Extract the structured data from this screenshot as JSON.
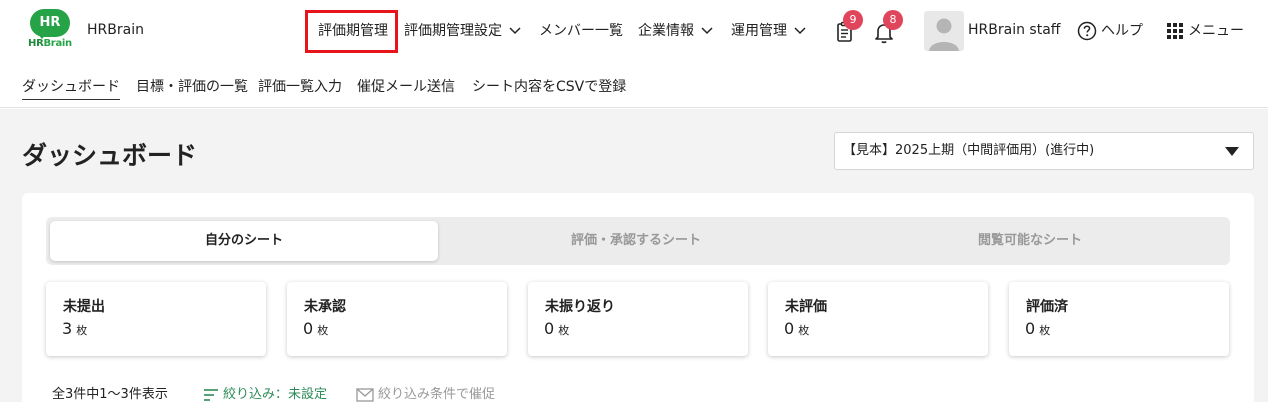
{
  "header": {
    "logo_text": "HR",
    "logo_sub_hr": "HR",
    "logo_sub_brain": "Brain",
    "brand_name": "HRBrain",
    "nav": [
      {
        "label": "評価期管理"
      },
      {
        "label": "評価期管理設定"
      },
      {
        "label": "メンバー一覧"
      },
      {
        "label": "企業情報"
      },
      {
        "label": "運用管理"
      }
    ],
    "tasks_badge": "9",
    "notifications_badge": "8",
    "user_name": "HRBrain staff",
    "help_label": "ヘルプ",
    "menu_label": "メニュー"
  },
  "subnav": {
    "items": [
      {
        "label": "ダッシュボード"
      },
      {
        "label": "目標・評価の一覧"
      },
      {
        "label": "評価一覧入力"
      },
      {
        "label": "催促メール送信"
      },
      {
        "label": "シート内容をCSVで登録"
      }
    ]
  },
  "main": {
    "title": "ダッシュボード",
    "period_selected": "【見本】2025上期（中間評価用）(進行中)",
    "tabs": [
      {
        "label": "自分のシート"
      },
      {
        "label": "評価・承認するシート"
      },
      {
        "label": "閲覧可能なシート"
      }
    ],
    "stats": [
      {
        "label": "未提出",
        "value": "3",
        "unit": "枚"
      },
      {
        "label": "未承認",
        "value": "0",
        "unit": "枚"
      },
      {
        "label": "未振り返り",
        "value": "0",
        "unit": "枚"
      },
      {
        "label": "未評価",
        "value": "0",
        "unit": "枚"
      },
      {
        "label": "評価済",
        "value": "0",
        "unit": "枚"
      }
    ],
    "count_text": "全3件中1〜3件表示",
    "filter_label": "絞り込み：未設定",
    "remind_label": "絞り込み条件で催促"
  },
  "colors": {
    "brand_green": "#27a347",
    "highlight_red": "#e8141c",
    "badge": "#e0455c",
    "link_green": "#2e8b57"
  }
}
